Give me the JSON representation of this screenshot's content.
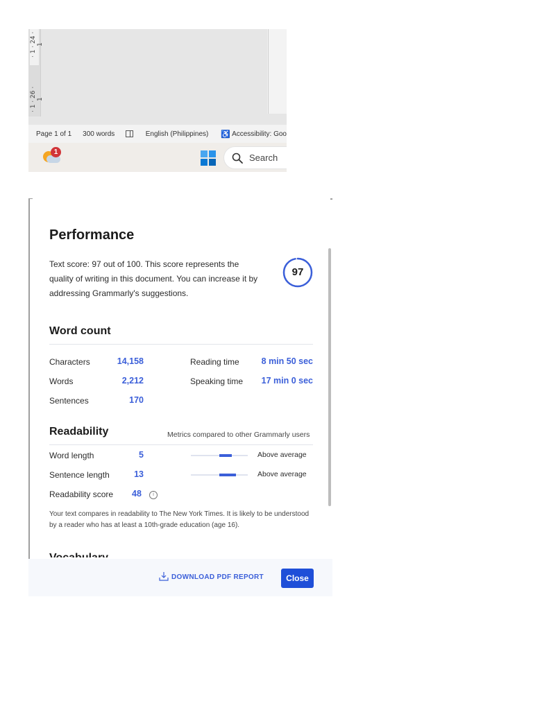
{
  "word": {
    "ruler_numbers": [
      "· 1 · 24 · 1",
      "· 1 · 26 · 1"
    ],
    "status": {
      "page": "Page 1 of 1",
      "words": "300 words",
      "language": "English (Philippines)",
      "accessibility": "Accessibility: Goo"
    },
    "taskbar": {
      "notification_count": "1",
      "search_label": "Search"
    }
  },
  "grammarly": {
    "title": "Performance",
    "description": "Text score: 97 out of 100. This score represents the quality of writing in this document. You can increase it by addressing Grammarly's suggestions.",
    "score": "97",
    "score_fraction": 0.97,
    "word_count": {
      "heading": "Word count",
      "characters_label": "Characters",
      "characters": "14,158",
      "words_label": "Words",
      "words": "2,212",
      "sentences_label": "Sentences",
      "sentences": "170",
      "reading_time_label": "Reading time",
      "reading_time": "8 min 50 sec",
      "speaking_time_label": "Speaking time",
      "speaking_time": "17 min 0 sec"
    },
    "readability": {
      "heading": "Readability",
      "note": "Metrics compared to other Grammarly users",
      "word_length_label": "Word length",
      "word_length": "5",
      "word_length_rating": "Above average",
      "sentence_length_label": "Sentence length",
      "sentence_length": "13",
      "sentence_length_rating": "Above average",
      "score_label": "Readability score",
      "score": "48",
      "summary": "Your text compares in readability to The New York Times. It is likely to be understood by a reader who has at least a 10th-grade education (age 16)."
    },
    "next_heading_partial": "Vocabulary",
    "footer": {
      "download_label": "DOWNLOAD PDF REPORT",
      "close_label": "Close"
    },
    "colors": {
      "accent": "#3b5fd9",
      "button": "#1f4fd8"
    }
  }
}
